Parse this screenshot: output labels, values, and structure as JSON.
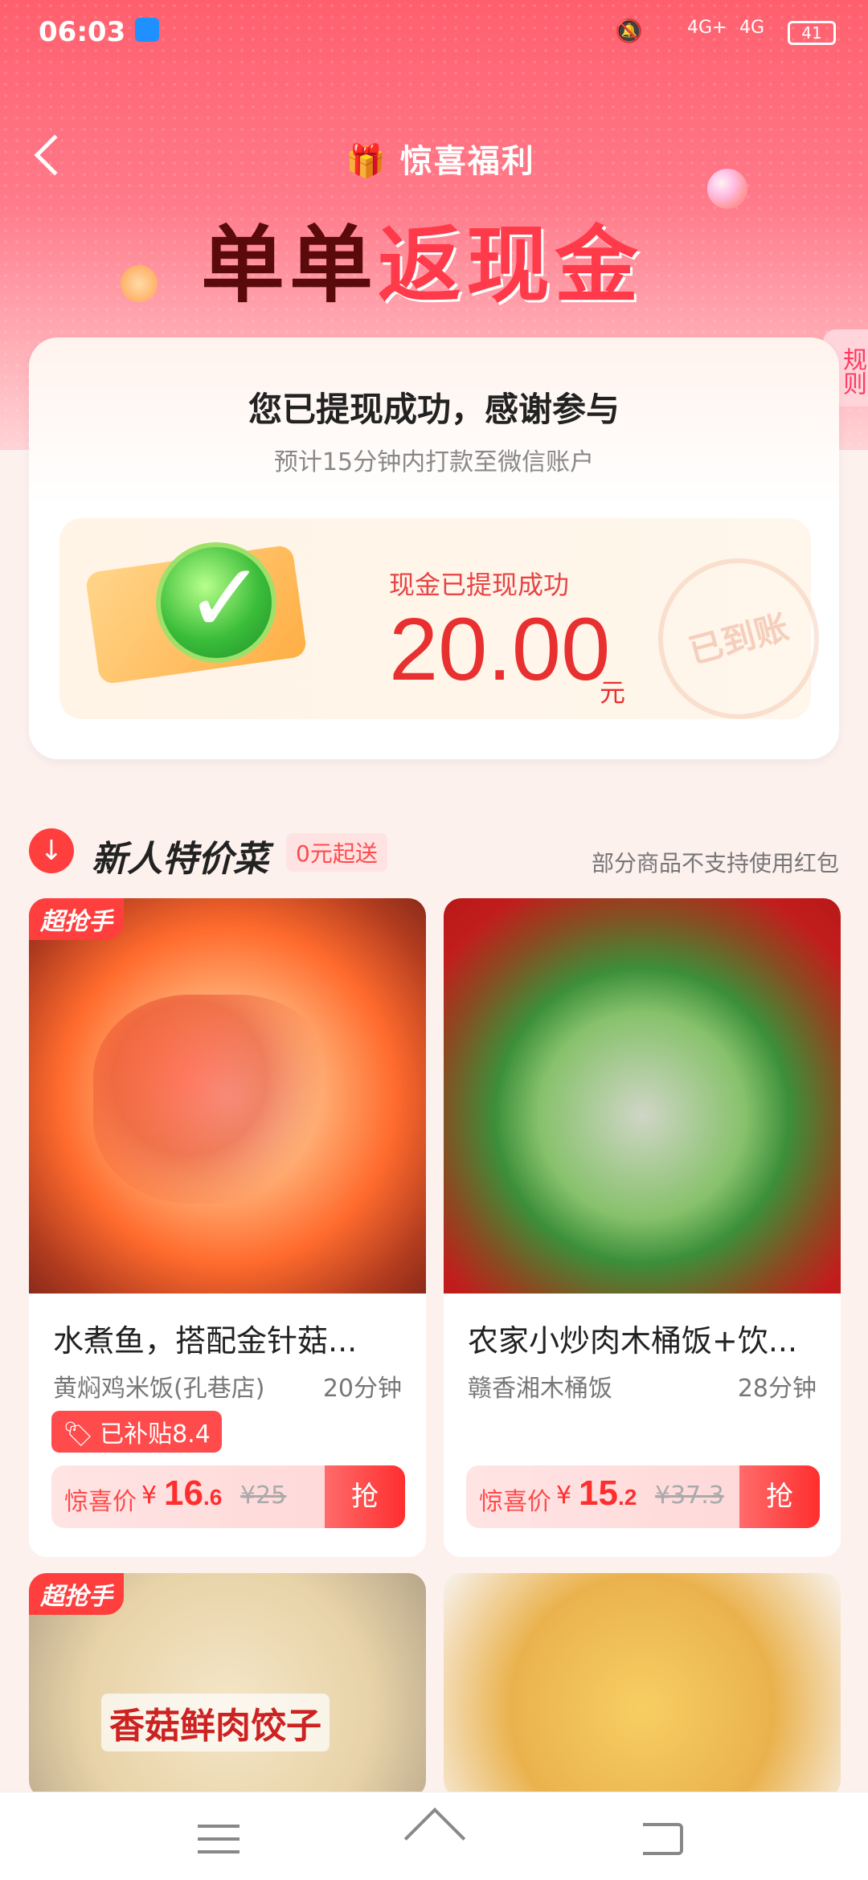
{
  "status_bar": {
    "time": "06:03",
    "battery": "41",
    "net1": "4G+",
    "net2": "4G"
  },
  "header": {
    "brand": "惊喜福利",
    "headline_part1": "单单",
    "headline_part2": "返现金",
    "rules": "规则"
  },
  "result_card": {
    "title": "您已提现成功，感谢参与",
    "subtitle": "预计15分钟内打款至微信账户",
    "label": "现金已提现成功",
    "amount": "20.00",
    "unit": "元",
    "stamp": "已到账"
  },
  "section": {
    "icon": "↓",
    "title": "新人特价菜",
    "tag": "0元起送",
    "note": "部分商品不支持使用红包"
  },
  "products": [
    {
      "badge": "超抢手",
      "name": "水煮鱼，搭配金针菇...",
      "shop": "黄焖鸡米饭(孔巷店)",
      "eta": "20分钟",
      "subsidy": "已补贴8.4",
      "price_label": "惊喜价",
      "currency": "¥",
      "price_int": "16",
      "price_dec": ".6",
      "orig": "¥25",
      "button": "抢"
    },
    {
      "badge": "",
      "name": "农家小炒肉木桶饭+饮...",
      "shop": "赣香湘木桶饭",
      "eta": "28分钟",
      "subsidy": "",
      "price_label": "惊喜价",
      "currency": "¥",
      "price_int": "15",
      "price_dec": ".2",
      "orig": "¥37.3",
      "button": "抢"
    },
    {
      "badge": "超抢手",
      "overlay": "香菇鲜肉饺子"
    },
    {
      "badge": ""
    }
  ]
}
